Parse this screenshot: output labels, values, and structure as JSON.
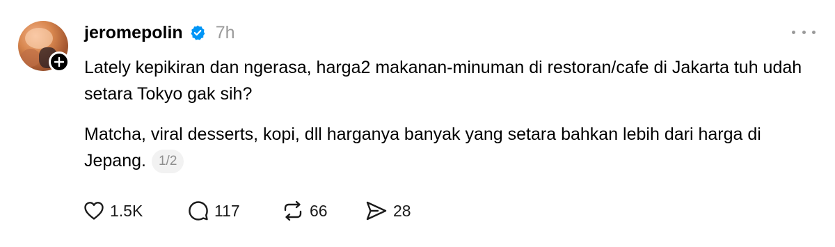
{
  "post": {
    "username": "jeromepolin",
    "time": "7h",
    "paragraphs": [
      "Lately kepikiran dan ngerasa, harga2 makanan-minuman di restoran/cafe di Jakarta tuh udah setara Tokyo gak sih?",
      "Matcha, viral desserts, kopi, dll harganya banyak yang setara bahkan lebih dari harga di Jepang."
    ],
    "page_indicator": "1/2",
    "icons": {
      "verified": "verified-badge-icon",
      "follow": "plus-icon",
      "more": "more-icon",
      "like": "heart-icon",
      "reply": "comment-icon",
      "repost": "repost-icon",
      "share": "send-icon"
    },
    "colors": {
      "verified": "#0095f6",
      "muted": "#9a9a9a",
      "text": "#000000"
    }
  },
  "actions": {
    "likes": "1.5K",
    "replies": "117",
    "reposts": "66",
    "shares": "28"
  }
}
